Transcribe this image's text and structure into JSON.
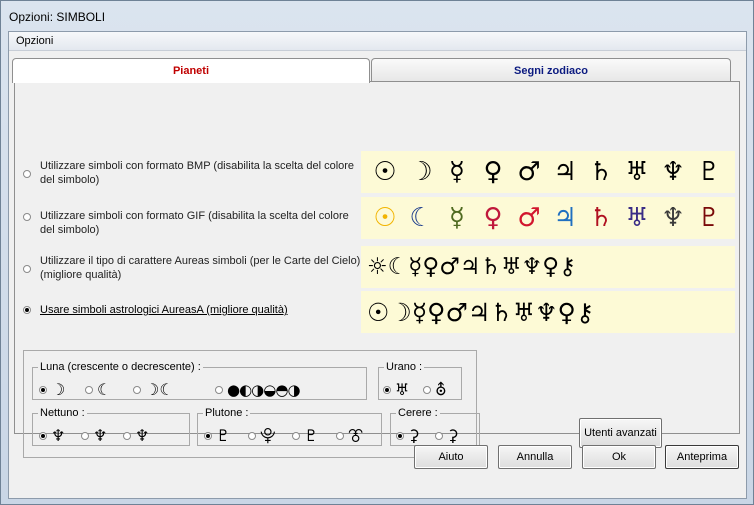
{
  "window": {
    "title": "Opzioni:  SIMBOLI"
  },
  "menu": {
    "label": "Opzioni"
  },
  "tabs": [
    {
      "label": "Pianeti",
      "active": true
    },
    {
      "label": "Segni zodiaco",
      "active": false
    }
  ],
  "options": [
    {
      "label": "Utilizzare simboli con formato BMP (disabilita la scelta del colore del simbolo)",
      "selected": false,
      "symbols": [
        "☉",
        "☽",
        "☿",
        "♀",
        "♂",
        "♃",
        "♄",
        "♅",
        "♆",
        "♇"
      ]
    },
    {
      "label": "Utilizzare simboli con formato GIF (disabilita la scelta del colore del simbolo)",
      "selected": false,
      "symbols": [
        "☉",
        "☾",
        "☿",
        "♀",
        "♂",
        "♃",
        "♄",
        "♅",
        "♆",
        "♇"
      ]
    },
    {
      "label": "Utilizzare il tipo di carattere Aureas simboli (per le Carte del Cielo) (migliore qualità)",
      "selected": false,
      "symbols": "☼☾☿♀♂♃♄♅♆♀⚷"
    },
    {
      "label": "Usare simboli astrologici AureasA (migliore qualità)",
      "selected": true,
      "symbols": "☉☽☿♀♂♃♄♅♆♀⚷"
    }
  ],
  "symbol_colors": {
    "gif": [
      "#f2b400",
      "#1a3b8c",
      "#4f6a20",
      "#c0183c",
      "#d2162e",
      "#1f6fc0",
      "#b01020",
      "#3a2d86",
      "#3a3a3a",
      "#7a0a0a"
    ]
  },
  "groups": {
    "luna": {
      "title": "Luna (crescente o decrescente) :",
      "choices": [
        "☽",
        "☾",
        "☽☾",
        "●◐◑◒◓◑"
      ],
      "selected": 0
    },
    "urano": {
      "title": "Urano :",
      "choices": [
        "♅",
        "⛢"
      ],
      "selected": 0
    },
    "nettuno": {
      "title": "Nettuno :",
      "choices": [
        "♆",
        "♆",
        "♆"
      ],
      "selected": 0
    },
    "plutone": {
      "title": "Plutone :",
      "choices": [
        "♇",
        "⯓",
        "♇",
        "⯔"
      ],
      "selected": 0
    },
    "cerere": {
      "title": "Cerere :",
      "choices": [
        "⚳",
        "⚳"
      ],
      "selected": 0
    }
  },
  "buttons": {
    "advanced": "Utenti avanzati",
    "help": "Aiuto",
    "cancel": "Annulla",
    "ok": "Ok",
    "preview": "Anteprima"
  }
}
